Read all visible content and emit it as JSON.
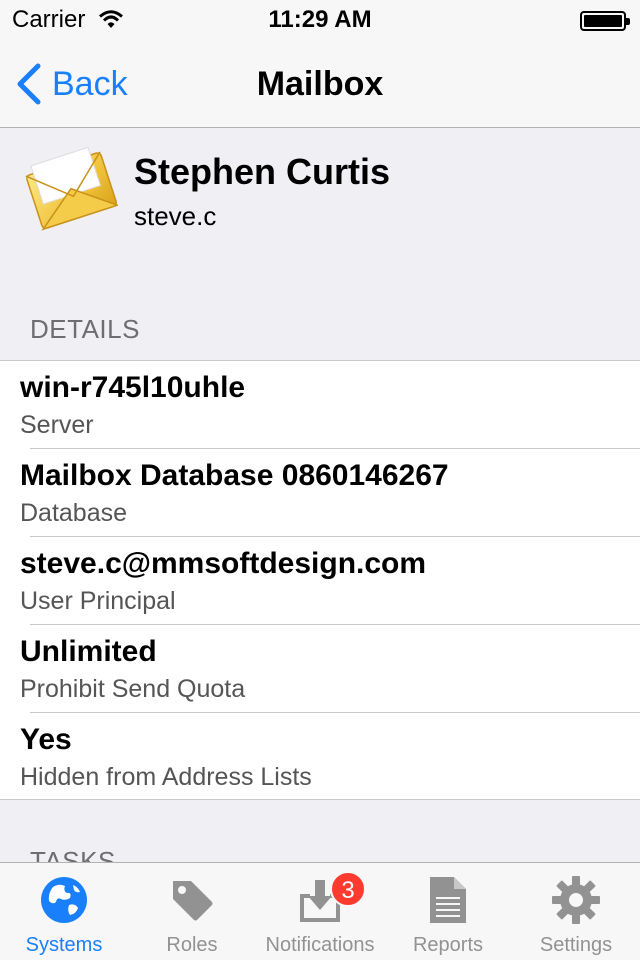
{
  "status_bar": {
    "carrier": "Carrier",
    "time": "11:29 AM"
  },
  "nav": {
    "back_label": "Back",
    "title": "Mailbox"
  },
  "header": {
    "name": "Stephen Curtis",
    "username": "steve.c"
  },
  "sections": {
    "details": "DETAILS",
    "tasks": "TASKS"
  },
  "details": [
    {
      "value": "win-r745l10uhle",
      "label": "Server"
    },
    {
      "value": "Mailbox Database 0860146267",
      "label": "Database"
    },
    {
      "value": "steve.c@mmsoftdesign.com",
      "label": "User Principal"
    },
    {
      "value": "Unlimited",
      "label": "Prohibit Send Quota"
    },
    {
      "value": "Yes",
      "label": "Hidden from Address Lists"
    }
  ],
  "tabs": [
    {
      "label": "Systems",
      "icon": "globe-icon",
      "active": true
    },
    {
      "label": "Roles",
      "icon": "tag-icon"
    },
    {
      "label": "Notifications",
      "icon": "inbox-download-icon",
      "badge": "3"
    },
    {
      "label": "Reports",
      "icon": "document-icon"
    },
    {
      "label": "Settings",
      "icon": "gear-icon"
    }
  ],
  "colors": {
    "accent": "#1a7ffb",
    "badge": "#ff3b30",
    "background": "#efeff4"
  }
}
